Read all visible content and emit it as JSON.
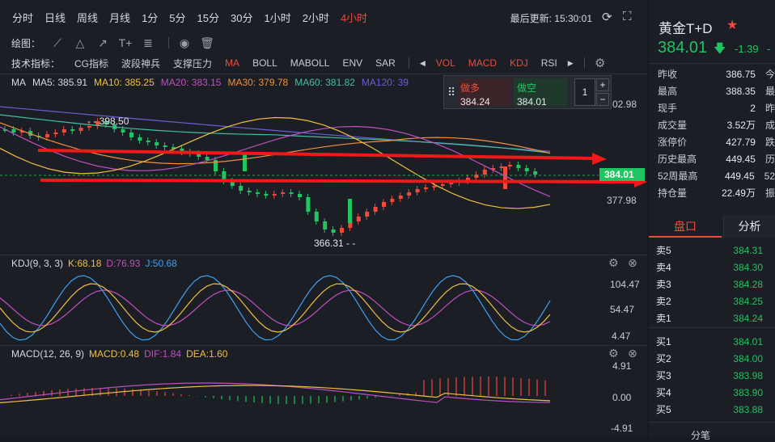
{
  "periods": [
    "分时",
    "日线",
    "周线",
    "月线",
    "1分",
    "5分",
    "15分",
    "30分",
    "1小时",
    "2小时",
    "4小时"
  ],
  "active_period": "4小时",
  "last_update": "最后更新: 15:30:01",
  "draw_label": "绘图：",
  "tech_label": "技术指标：",
  "indicators_left": [
    "CG指标",
    "波段神兵",
    "支撑压力",
    "MA",
    "BOLL",
    "MABOLL",
    "ENV",
    "SAR"
  ],
  "indicators_right": [
    "VOL",
    "MACD",
    "KDJ",
    "RSI"
  ],
  "ma": {
    "label": "MA",
    "items": [
      {
        "text": "MA5: 385.91",
        "color": "#d6d9df"
      },
      {
        "text": "MA10: 385.25",
        "color": "#f0c040"
      },
      {
        "text": "MA20: 383.15",
        "color": "#c050c0"
      },
      {
        "text": "MA30: 379.78",
        "color": "#f09040"
      },
      {
        "text": "MA60: 381.82",
        "color": "#40c0a0"
      },
      {
        "text": "MA120: 39",
        "color": "#6a5fd8"
      }
    ]
  },
  "trade": {
    "sell_label": "做多",
    "sell_price": "384.24",
    "buy_label": "做空",
    "buy_price": "384.01",
    "qty": "1",
    "plus": "+",
    "minus": "−"
  },
  "price_axis": {
    "top": "02.98",
    "current": "384.01",
    "low": "377.98"
  },
  "annotations": {
    "high": "398.50",
    "low": "366.31"
  },
  "kdj": {
    "title": "KDJ(9, 3, 3)",
    "k": "K:68.18",
    "d": "D:76.93",
    "j": "J:50.68",
    "axis": [
      "104.47",
      "54.47",
      "4.47"
    ]
  },
  "macd": {
    "title": "MACD(12, 26, 9)",
    "macd": "MACD:0.48",
    "dif": "DIF:1.84",
    "dea": "DEA:1.60",
    "axis": [
      "4.91",
      "0.00",
      "-4.91"
    ]
  },
  "colors": {
    "up": "#f04a3c",
    "down": "#1fc560",
    "arrow": "#f01818"
  },
  "quote": {
    "name": "黄金T+D",
    "price": "384.01",
    "change": "-1.39",
    "change_pct": "-",
    "stats": [
      {
        "k": "昨收",
        "v": "386.75",
        "x": "今"
      },
      {
        "k": "最高",
        "v": "388.35",
        "x": "最"
      },
      {
        "k": "现手",
        "v": "2",
        "x": "昨"
      },
      {
        "k": "成交量",
        "v": "3.52万",
        "x": "成"
      },
      {
        "k": "涨停价",
        "v": "427.79",
        "x": "跌"
      },
      {
        "k": "历史最高",
        "v": "449.45",
        "x": "历"
      },
      {
        "k": "52周最高",
        "v": "449.45",
        "x": "52"
      },
      {
        "k": "持仓量",
        "v": "22.49万",
        "x": "振"
      }
    ]
  },
  "tabs": {
    "orderbook": "盘口",
    "analysis": "分析"
  },
  "orderbook": {
    "sells": [
      {
        "k": "卖5",
        "v": "384.31"
      },
      {
        "k": "卖4",
        "v": "384.30"
      },
      {
        "k": "卖3",
        "v": "384.28"
      },
      {
        "k": "卖2",
        "v": "384.25"
      },
      {
        "k": "卖1",
        "v": "384.24"
      }
    ],
    "buys": [
      {
        "k": "买1",
        "v": "384.01"
      },
      {
        "k": "买2",
        "v": "384.00"
      },
      {
        "k": "买3",
        "v": "383.98"
      },
      {
        "k": "买4",
        "v": "383.90"
      },
      {
        "k": "买5",
        "v": "383.88"
      }
    ]
  },
  "bottom_label": "分笔"
}
